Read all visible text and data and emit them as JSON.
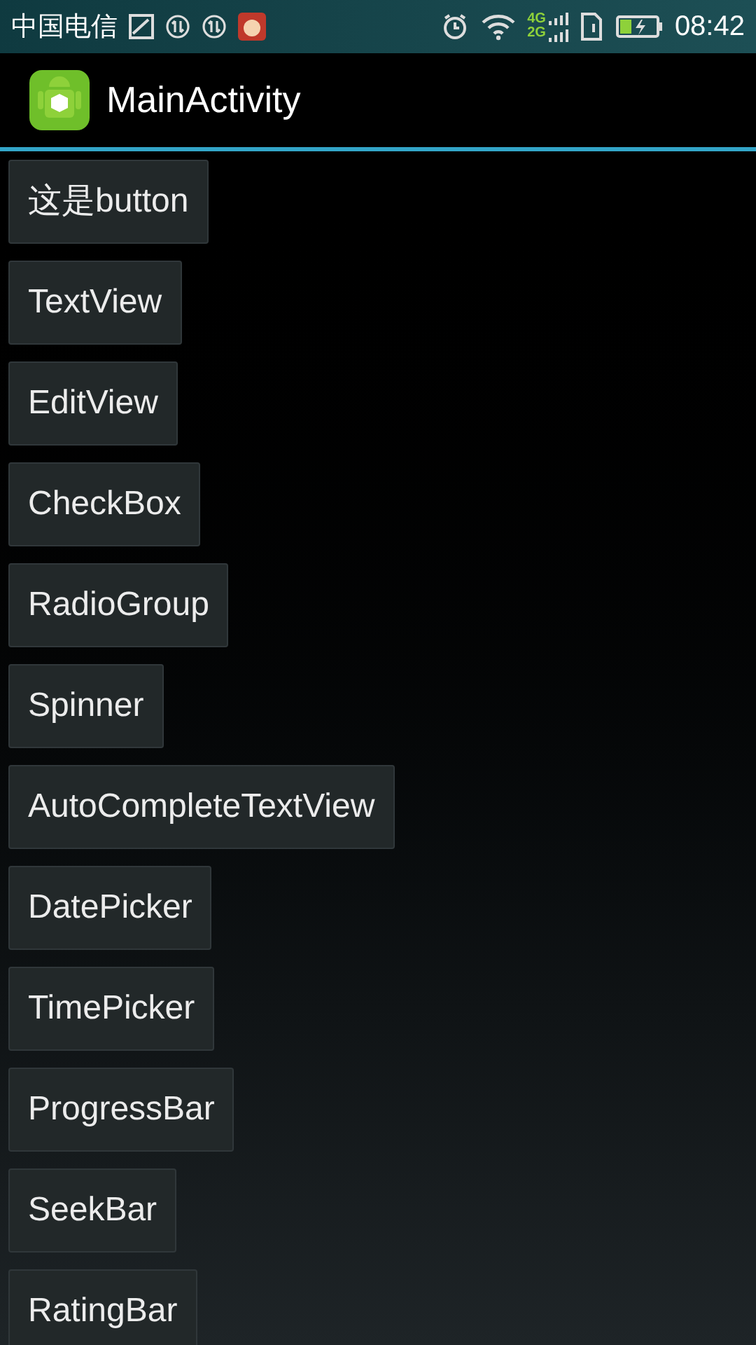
{
  "status_bar": {
    "carrier": "中国电信",
    "network_label_top": "4G",
    "network_label_bottom": "2G",
    "time": "08:42"
  },
  "action_bar": {
    "title": "MainActivity"
  },
  "buttons": [
    "这是button",
    "TextView",
    "EditView",
    "CheckBox",
    "RadioGroup",
    "Spinner",
    "AutoCompleteTextView",
    "DatePicker",
    "TimePicker",
    "ProgressBar",
    "SeekBar",
    "RatingBar"
  ]
}
